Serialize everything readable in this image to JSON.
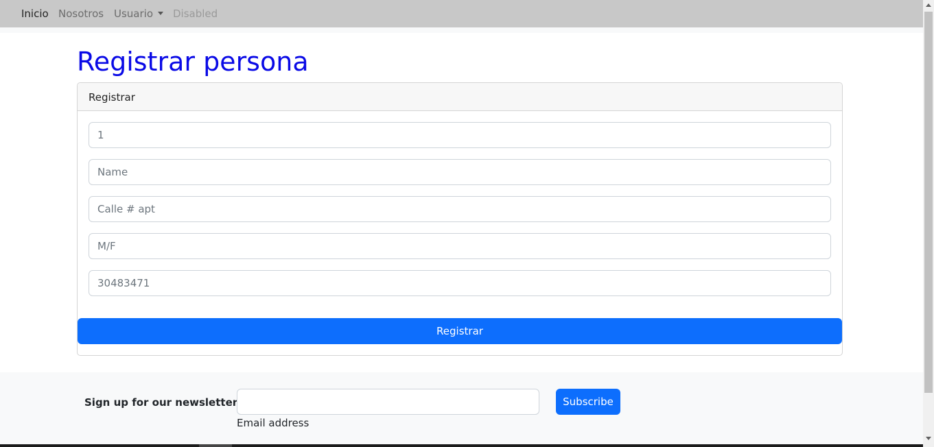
{
  "nav": {
    "items": [
      {
        "label": "Inicio",
        "state": "active"
      },
      {
        "label": "Nosotros",
        "state": "normal"
      },
      {
        "label": "Usuario",
        "state": "dropdown"
      },
      {
        "label": "Disabled",
        "state": "disabled"
      }
    ]
  },
  "page": {
    "title": "Registrar persona"
  },
  "card": {
    "header": "Registrar",
    "fields": [
      {
        "name": "id",
        "value": "",
        "placeholder": "1"
      },
      {
        "name": "name",
        "value": "",
        "placeholder": "Name"
      },
      {
        "name": "address",
        "value": "",
        "placeholder": "Calle # apt"
      },
      {
        "name": "gender",
        "value": "",
        "placeholder": "M/F"
      },
      {
        "name": "phone",
        "value": "",
        "placeholder": "30483471"
      }
    ],
    "submit_label": "Registrar"
  },
  "footer": {
    "newsletter_label": "Sign up for our newsletter",
    "email_value": "",
    "email_label": "Email address",
    "subscribe_label": "Subscribe"
  },
  "colors": {
    "title": "#0a0ae6",
    "primary": "#0d6efd",
    "navbar": "#c8c8c8"
  }
}
